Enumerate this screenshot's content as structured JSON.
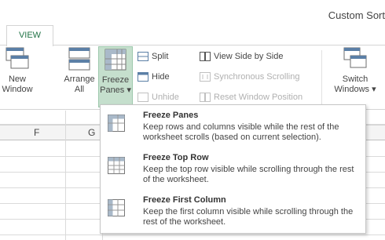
{
  "window": {
    "title": "Custom Sort"
  },
  "tabs": {
    "active": "VIEW"
  },
  "ribbon": {
    "new_window": {
      "line1": "New",
      "line2": "Window"
    },
    "arrange_all": {
      "line1": "Arrange",
      "line2": "All"
    },
    "freeze_panes": {
      "line1": "Freeze",
      "line2": "Panes ▾"
    },
    "split": "Split",
    "hide": "Hide",
    "unhide": "Unhide",
    "view_side_by_side": "View Side by Side",
    "synchronous_scrolling": "Synchronous Scrolling",
    "reset_window_position": "Reset Window Position",
    "switch_windows": {
      "line1": "Switch",
      "line2": "Windows ▾"
    }
  },
  "grid": {
    "columns": [
      "F",
      "G"
    ]
  },
  "freeze_menu": {
    "items": [
      {
        "title": "Freeze Panes",
        "description": "Keep rows and columns visible while the rest of the worksheet scrolls (based on current selection)."
      },
      {
        "title": "Freeze Top Row",
        "description": "Keep the top row visible while scrolling through the rest of the worksheet."
      },
      {
        "title": "Freeze First Column",
        "description": "Keep the first column visible while scrolling through the rest of the worksheet."
      }
    ]
  },
  "colors": {
    "accent": "#217346",
    "highlight": "#c5dfcd"
  }
}
